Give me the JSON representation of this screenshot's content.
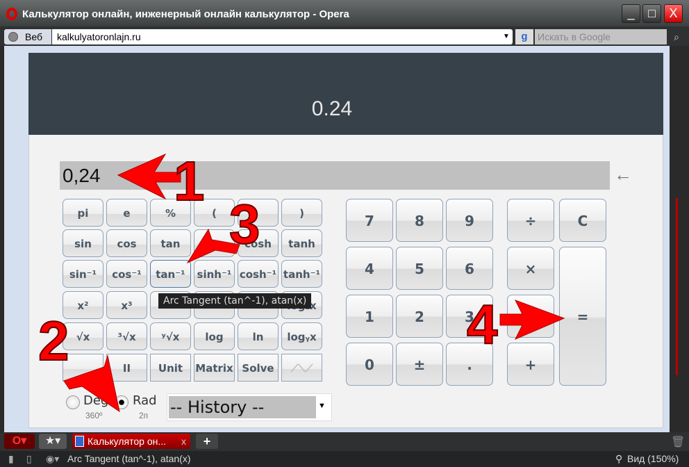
{
  "window": {
    "title": "Калькулятор онлайн, инженерный онлайн калькулятор - Opera",
    "controls": {
      "minimize": "_",
      "maximize": "□",
      "close": "X"
    }
  },
  "addressbar": {
    "web_label": "Веб",
    "url": "kalkulyatoronlajn.ru",
    "search_placeholder": "Искать в Google",
    "search_engine_icon": "g"
  },
  "calculator": {
    "display_result": "0.24",
    "input_value": "0,24",
    "backspace": "←",
    "function_rows": [
      [
        "pi",
        "e",
        "%",
        "(",
        "",
        ")"
      ],
      [
        "sin",
        "cos",
        "tan",
        "",
        "cosh",
        "tanh"
      ],
      [
        "sin⁻¹",
        "cos⁻¹",
        "tan⁻¹",
        "sinh⁻¹",
        "cosh⁻¹",
        "tanh⁻¹"
      ],
      [
        "x²",
        "x³",
        "",
        "",
        "",
        "log₂x"
      ],
      [
        "√x",
        "³√x",
        "ʸ√x",
        "log",
        "ln",
        "logᵧx"
      ],
      [
        "",
        "II",
        "Unit",
        "Matrix",
        "Solve",
        ""
      ]
    ],
    "number_rows": [
      [
        "7",
        "8",
        "9"
      ],
      [
        "4",
        "5",
        "6"
      ],
      [
        "1",
        "2",
        "3"
      ],
      [
        "0",
        "±",
        "."
      ]
    ],
    "operators": {
      "divide": "÷",
      "clear": "C",
      "multiply": "×",
      "minus": "−",
      "plus": "+",
      "equals": "="
    },
    "tooltip": "Arc Tangent (tan^-1), atan(x)",
    "angle_mode": {
      "deg_label": "Deg",
      "deg_sub": "360º",
      "rad_label": "Rad",
      "rad_sub": "2п",
      "selected": "Rad"
    },
    "history": "-- History --"
  },
  "annotations": {
    "n1": "1",
    "n2": "2",
    "n3": "3",
    "n4": "4",
    "color": "#ff0000"
  },
  "tabbar": {
    "tab_title": "Калькулятор он...",
    "tab_close": "x",
    "new_tab": "+"
  },
  "statusbar": {
    "status_text": "Arc Tangent (tan^-1), atan(x)",
    "zoom": "Вид (150%)"
  }
}
